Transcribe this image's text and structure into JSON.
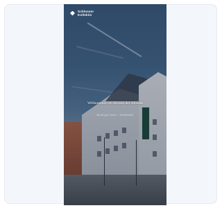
{
  "brand": {
    "line1": "Schlosser",
    "line2": "Kollektiv"
  },
  "hero": {
    "headline": "Willkommen im Herzen der Altstadt",
    "subline": "Boutique Hotel · Stadtmitte"
  },
  "colors": {
    "sky": "#46698d",
    "text": "#ffffff",
    "frame": "#f7f9fc"
  },
  "icons": {
    "logo": "diamond-logo-icon"
  }
}
